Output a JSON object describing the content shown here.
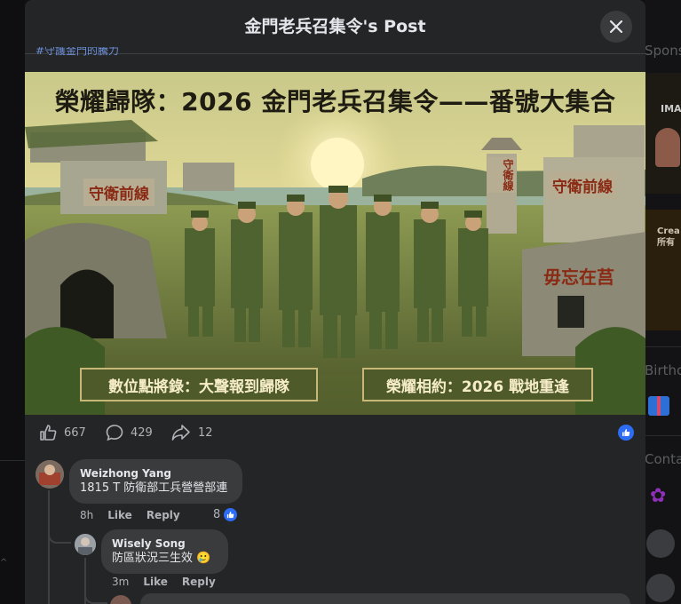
{
  "dialog": {
    "title": "金門老兵召集令's Post",
    "hashtag": "#守護金門的騰力"
  },
  "post_image": {
    "title": "榮耀歸隊：2026 金門老兵召集令——番號大集合",
    "banner_left": "數位點將錄：大聲報到歸隊",
    "banner_right": "榮耀相約：2026 戰地重逢",
    "sign_left": "守衛前線",
    "sign_right": "守衛前線",
    "sign_tower": "守衛線",
    "sign_rock": "毋忘在莒"
  },
  "actions": {
    "like_count": "667",
    "comment_count": "429",
    "share_count": "12"
  },
  "comments": [
    {
      "author": "Weizhong Yang",
      "text": "1815 T 防衛部工兵營營部連",
      "time": "8h",
      "like_label": "Like",
      "reply_label": "Reply",
      "reaction_count": "8"
    },
    {
      "author": "Wisely Song",
      "text": "防區狀況三生效 🥲",
      "time": "3m",
      "like_label": "Like",
      "reply_label": "Reply"
    }
  ],
  "background": {
    "sponsored_label": "Sponso",
    "ad1_text": "IMA",
    "ad2_text": "Crea\n所有",
    "birthdays_label": "Birtho",
    "contacts_label": "Conta"
  },
  "colors": {
    "dialog_bg": "#242526",
    "bubble_bg": "#3a3b3c",
    "accent_blue": "#2d6cf5",
    "text_primary": "#e4e6eb",
    "text_secondary": "#b0b3b8"
  }
}
